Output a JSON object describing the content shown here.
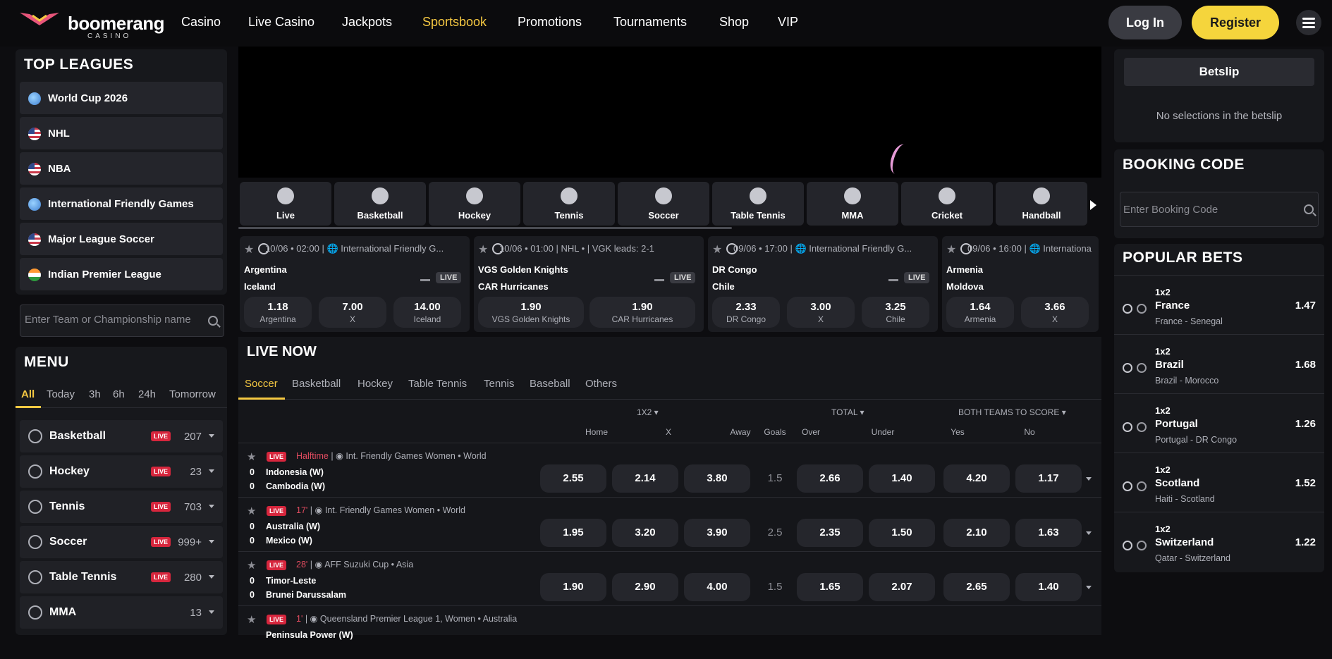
{
  "brand": {
    "name": "boomerang",
    "tagline": "CASINO"
  },
  "nav": [
    {
      "label": "Casino",
      "active": false
    },
    {
      "label": "Live Casino",
      "active": false
    },
    {
      "label": "Jackpots",
      "active": false
    },
    {
      "label": "Sportsbook",
      "active": true
    },
    {
      "label": "Promotions",
      "active": false
    },
    {
      "label": "Tournaments",
      "active": false
    },
    {
      "label": "Shop",
      "active": false
    },
    {
      "label": "VIP",
      "active": false
    }
  ],
  "auth": {
    "login": "Log In",
    "register": "Register"
  },
  "top_leagues": {
    "title": "TOP LEAGUES",
    "items": [
      {
        "label": "World Cup 2026",
        "flag": "globe"
      },
      {
        "label": "NHL",
        "flag": "us"
      },
      {
        "label": "NBA",
        "flag": "us"
      },
      {
        "label": "International Friendly Games",
        "flag": "globe"
      },
      {
        "label": "Major League Soccer",
        "flag": "us"
      },
      {
        "label": "Indian Premier League",
        "flag": "in"
      }
    ]
  },
  "team_search": {
    "placeholder": "Enter Team or Championship name"
  },
  "menu": {
    "title": "MENU",
    "time_filters": [
      "All",
      "Today",
      "3h",
      "6h",
      "24h",
      "Tomorrow"
    ],
    "active_filter": "All",
    "live_label": "LIVE",
    "sports": [
      {
        "label": "Basketball",
        "live": true,
        "count": "207",
        "icon": "basketball-icon"
      },
      {
        "label": "Hockey",
        "live": true,
        "count": "23",
        "icon": "hockey-icon"
      },
      {
        "label": "Tennis",
        "live": true,
        "count": "703",
        "icon": "tennis-icon"
      },
      {
        "label": "Soccer",
        "live": true,
        "count": "999+",
        "icon": "soccer-icon"
      },
      {
        "label": "Table Tennis",
        "live": true,
        "count": "280",
        "icon": "table-tennis-icon"
      },
      {
        "label": "MMA",
        "live": false,
        "count": "13",
        "icon": "mma-icon"
      }
    ]
  },
  "sport_tabs": [
    "Live",
    "Basketball",
    "Hockey",
    "Tennis",
    "Soccer",
    "Table Tennis",
    "MMA",
    "Cricket",
    "Handball"
  ],
  "featured": [
    {
      "meta": "10/06 • 02:00 | 🌐 International Friendly G...",
      "team1": "Argentina",
      "team2": "Iceland",
      "live": true,
      "odds": [
        {
          "v": "1.18",
          "l": "Argentina"
        },
        {
          "v": "7.00",
          "l": "X"
        },
        {
          "v": "14.00",
          "l": "Iceland"
        }
      ]
    },
    {
      "meta": "10/06 • 01:00 | NHL • | VGK leads: 2-1",
      "team1": "VGS Golden Knights",
      "team2": "CAR Hurricanes",
      "live": true,
      "odds": [
        {
          "v": "1.90",
          "l": "VGS Golden Knights"
        },
        {
          "v": "1.90",
          "l": "CAR Hurricanes"
        }
      ]
    },
    {
      "meta": "09/06 • 17:00 | 🌐 International Friendly G...",
      "team1": "DR Congo",
      "team2": "Chile",
      "live": true,
      "odds": [
        {
          "v": "2.33",
          "l": "DR Congo"
        },
        {
          "v": "3.00",
          "l": "X"
        },
        {
          "v": "3.25",
          "l": "Chile"
        }
      ]
    },
    {
      "meta": "09/06 • 16:00 | 🌐 Internationa",
      "team1": "Armenia",
      "team2": "Moldova",
      "live": false,
      "odds": [
        {
          "v": "1.64",
          "l": "Armenia"
        },
        {
          "v": "3.66",
          "l": "X"
        }
      ]
    }
  ],
  "live_now": {
    "title": "LIVE NOW",
    "tabs": [
      "Soccer",
      "Basketball",
      "Hockey",
      "Table Tennis",
      "Tennis",
      "Baseball",
      "Others"
    ],
    "groups": [
      "1X2 ▾",
      "TOTAL ▾",
      "BOTH TEAMS TO SCORE ▾"
    ],
    "cols": [
      "Home",
      "X",
      "Away",
      "Goals",
      "Over",
      "Under",
      "Yes",
      "No"
    ],
    "events": [
      {
        "status": "Halftime",
        "league": "Int. Friendly Games Women",
        "region": "World",
        "home": "Indonesia (W)",
        "away": "Cambodia (W)",
        "sh": "0",
        "sa": "0",
        "odds": [
          "2.55",
          "2.14",
          "3.80",
          "1.5",
          "2.66",
          "1.40",
          "4.20",
          "1.17"
        ]
      },
      {
        "status": "17'",
        "league": "Int. Friendly Games Women",
        "region": "World",
        "home": "Australia (W)",
        "away": "Mexico (W)",
        "sh": "0",
        "sa": "0",
        "odds": [
          "1.95",
          "3.20",
          "3.90",
          "2.5",
          "2.35",
          "1.50",
          "2.10",
          "1.63"
        ]
      },
      {
        "status": "28'",
        "league": "AFF Suzuki Cup",
        "region": "Asia",
        "home": "Timor-Leste",
        "away": "Brunei Darussalam",
        "sh": "0",
        "sa": "0",
        "odds": [
          "1.90",
          "2.90",
          "4.00",
          "1.5",
          "1.65",
          "2.07",
          "2.65",
          "1.40"
        ]
      },
      {
        "status": "1'",
        "league": "Queensland Premier League 1, Women",
        "region": "Australia",
        "home": "Peninsula Power (W)",
        "away": "",
        "sh": "",
        "sa": "",
        "odds": [
          "",
          "",
          "",
          "",
          "",
          "",
          "",
          ""
        ]
      }
    ]
  },
  "betslip": {
    "title": "Betslip",
    "empty": "No selections in the betslip"
  },
  "booking": {
    "title": "BOOKING CODE",
    "placeholder": "Enter Booking Code"
  },
  "popular_bets": {
    "title": "POPULAR BETS",
    "items": [
      {
        "market": "1x2",
        "selection": "France",
        "event": "France - Senegal",
        "odd": "1.47"
      },
      {
        "market": "1x2",
        "selection": "Brazil",
        "event": "Brazil - Morocco",
        "odd": "1.68"
      },
      {
        "market": "1x2",
        "selection": "Portugal",
        "event": "Portugal - DR Congo",
        "odd": "1.26"
      },
      {
        "market": "1x2",
        "selection": "Scotland",
        "event": "Haiti - Scotland",
        "odd": "1.52"
      },
      {
        "market": "1x2",
        "selection": "Switzerland",
        "event": "Qatar - Switzerland",
        "odd": "1.22"
      }
    ]
  },
  "colors": {
    "accent": "#f5c842",
    "live": "#d7263d",
    "brand_pink": "#e8557a"
  }
}
